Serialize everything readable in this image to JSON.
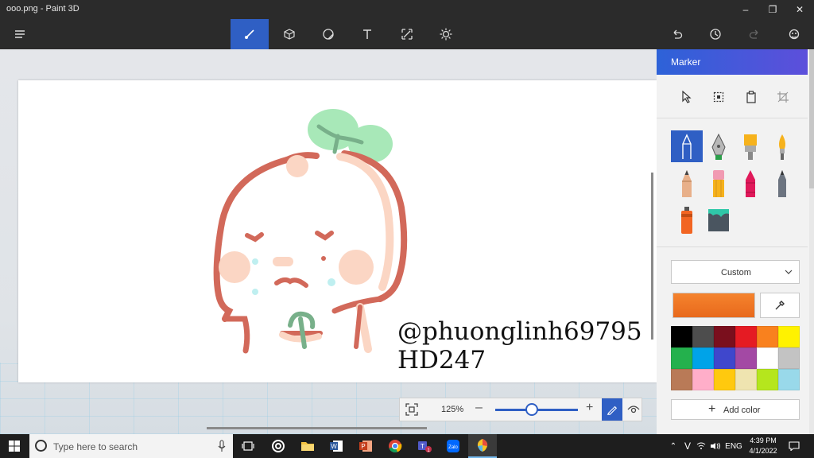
{
  "window": {
    "title": "ooo.png - Paint 3D"
  },
  "toolbar": {
    "items": [
      "menu-icon",
      "brushes-icon",
      "3d-shapes-icon",
      "stickers-icon",
      "text-icon",
      "canvas-icon",
      "effects-icon",
      "undo-icon",
      "history-icon",
      "redo-icon",
      "3d-library-icon"
    ]
  },
  "canvas": {
    "watermark_line1": "@phuonglinh69795",
    "watermark_line2": "HD247"
  },
  "zoom": {
    "percent": "125%",
    "level": 0.44
  },
  "panel": {
    "title": "Marker",
    "tools": [
      "select-icon",
      "crop-region-icon",
      "paste-icon",
      "crop-icon"
    ],
    "brushes": [
      "marker",
      "calligraphy-pen",
      "oil-brush",
      "watercolor",
      "pencil",
      "eraser",
      "crayon",
      "pixel-pen",
      "spray-can",
      "fill"
    ],
    "thickness_dropdown": "Custom",
    "current_color": "#f5832d",
    "swatches": [
      "#000000",
      "#4d4d4d",
      "#7a0f1d",
      "#e51b23",
      "#f9811e",
      "#fff200",
      "#24b14d",
      "#00a3e8",
      "#3f47cc",
      "#a349a4",
      "#ffffff",
      "#c3c3c3",
      "#b97a57",
      "#ffaec9",
      "#ffc90e",
      "#efe4b0",
      "#b5e61d",
      "#99d9ea"
    ],
    "add_color": "Add color"
  },
  "taskbar": {
    "search_placeholder": "Type here to search",
    "language": "ENG",
    "time": "4:39 PM",
    "date": "4/1/2022"
  }
}
